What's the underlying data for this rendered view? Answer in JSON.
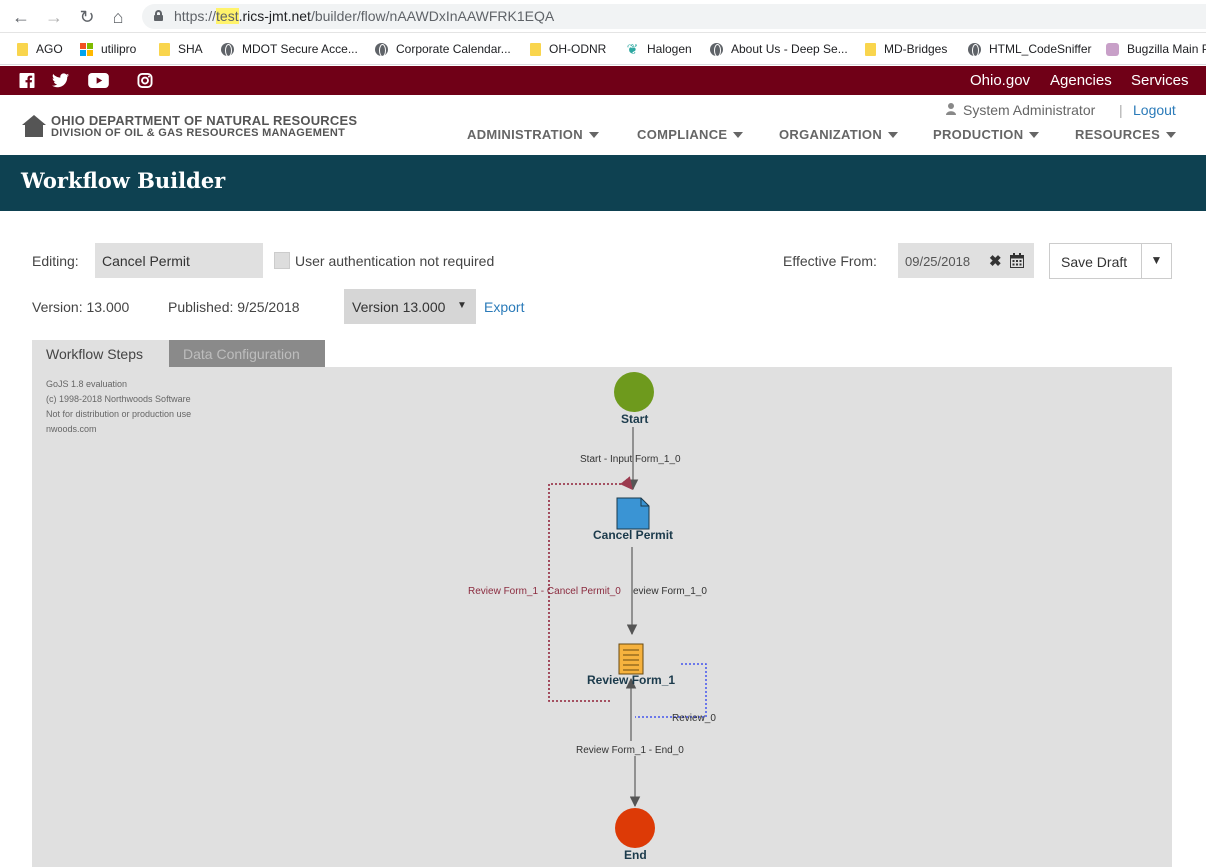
{
  "browser": {
    "url_prefix": "https://",
    "url_highlight": "test",
    "url_domain": ".rics-jmt.net",
    "url_path": "/builder/flow/nAAWDxInAAWFRK1EQA",
    "bookmarks": [
      {
        "label": "AGO",
        "icon": "folder-icon"
      },
      {
        "label": "utilipro",
        "icon": "microsoft-icon"
      },
      {
        "label": "SHA",
        "icon": "folder-icon"
      },
      {
        "label": "MDOT Secure Acce...",
        "icon": "globe-icon"
      },
      {
        "label": "Corporate Calendar...",
        "icon": "globe-icon"
      },
      {
        "label": "OH-ODNR",
        "icon": "folder-icon"
      },
      {
        "label": "Halogen",
        "icon": "leaf-icon"
      },
      {
        "label": "About Us - Deep Se...",
        "icon": "globe-icon"
      },
      {
        "label": "MD-Bridges",
        "icon": "folder-icon"
      },
      {
        "label": "HTML_CodeSniffer",
        "icon": "globe-icon"
      },
      {
        "label": "Bugzilla Main P",
        "icon": "bug-icon"
      }
    ]
  },
  "topbar": {
    "links": [
      "Ohio.gov",
      "Agencies",
      "Services"
    ]
  },
  "header": {
    "logo_line1": "OHIO DEPARTMENT OF NATURAL RESOURCES",
    "logo_line2": "DIVISION OF OIL & GAS RESOURCES MANAGEMENT",
    "user": "System Administrator",
    "separator": "|",
    "logout": "Logout",
    "nav": [
      "ADMINISTRATION",
      "COMPLIANCE",
      "ORGANIZATION",
      "PRODUCTION",
      "RESOURCES"
    ]
  },
  "banner": {
    "title": "Workflow Builder"
  },
  "form": {
    "editing_label": "Editing:",
    "editing_value": "Cancel Permit",
    "auth_label": "User authentication not required",
    "effective_label": "Effective From:",
    "effective_value": "09/25/2018",
    "save_label": "Save Draft",
    "version_text": "Version: 13.000",
    "published_text": "Published: 9/25/2018",
    "version_select": "Version 13.000",
    "export_label": "Export"
  },
  "tabs": [
    "Workflow Steps",
    "Data Configuration"
  ],
  "canvas": {
    "watermark": [
      "GoJS 1.8 evaluation",
      "(c) 1998-2018 Northwoods Software",
      "Not for distribution or production use",
      "nwoods.com"
    ],
    "nodes": {
      "start": "Start",
      "cancel": "Cancel Permit",
      "review": "Review Form_1",
      "end": "End"
    },
    "links": {
      "start_input": "Start - Input Form_1_0",
      "review_cancel": "Review Form_1 - Cancel Permit_0",
      "review_tail": "eview Form_1_0",
      "review_self": "Review_0",
      "review_end": "Review Form_1 - End_0"
    },
    "colors": {
      "start": "#6e9a1d",
      "end": "#dd3a06",
      "doc": "#3a94d4",
      "form": "#f6b23e",
      "loop_red": "#9b3b4f",
      "loop_blue": "#4455ee"
    }
  }
}
